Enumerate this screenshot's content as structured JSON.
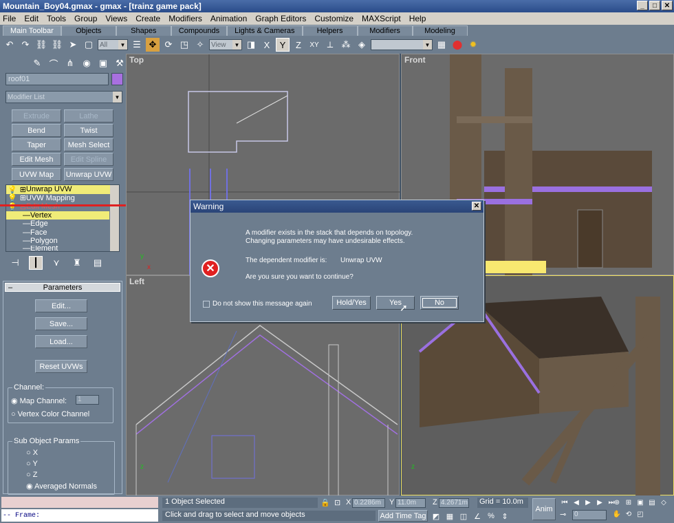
{
  "window": {
    "title": "Mountain_Boy04.gmax - gmax - [trainz game pack]",
    "min": "_",
    "max": "□",
    "close": "✕"
  },
  "menu": [
    "File",
    "Edit",
    "Tools",
    "Group",
    "Views",
    "Create",
    "Modifiers",
    "Animation",
    "Graph Editors",
    "Customize",
    "MAXScript",
    "Help"
  ],
  "tabs": [
    "Main Toolbar",
    "Objects",
    "Shapes",
    "Compounds",
    "Lights & Cameras",
    "Helpers",
    "Modifiers",
    "Modeling"
  ],
  "toolbar": {
    "filter_value": "All",
    "refcoord_value": "View",
    "selection_set": ""
  },
  "panel": {
    "object_name": "roof01",
    "modifier_list": "Modifier List",
    "buttons": [
      "Extrude",
      "Lathe",
      "Bend",
      "Twist",
      "Taper",
      "Mesh Select",
      "Edit Mesh",
      "Edit Spline",
      "UVW Map",
      "Unwrap UVW"
    ],
    "stack": [
      "Unwrap UVW",
      "UVW Mapping",
      "Edit Mesh",
      "Vertex",
      "Edge",
      "Face",
      "Polygon",
      "Element"
    ],
    "rollout_title": "Parameters",
    "edit_label": "Edit...",
    "save_label": "Save...",
    "load_label": "Load...",
    "reset_label": "Reset UVWs",
    "channel_title": "Channel:",
    "map_channel_label": "Map Channel:",
    "map_channel_value": "1",
    "vertex_color_label": "Vertex Color Channel",
    "subobj_title": "Sub Object Params",
    "axis_x": "X",
    "axis_y": "Y",
    "axis_z": "Z",
    "averaged_normals": "Averaged Normals"
  },
  "viewports": {
    "top": "Top",
    "front": "Front",
    "left": "Left",
    "persp": ""
  },
  "dialog": {
    "title": "Warning",
    "line1": "A modifier exists in the stack that depends on topology.",
    "line2": "Changing parameters may have undesirable effects.",
    "dep_label": "The dependent modifier is:",
    "dep_value": "Unwrap UVW",
    "question": "Are you sure you want to continue?",
    "checkbox_label": "Do not show this message again",
    "btn_hold": "Hold/Yes",
    "btn_yes": "Yes",
    "btn_no": "No"
  },
  "status": {
    "script_line": "-- Frame:",
    "selection": "1 Object Selected",
    "prompt": "Click and drag to select and move objects",
    "x_value": "0.2286m",
    "y_value": "11.0m",
    "z_value": "4.2671m",
    "grid": "Grid = 10.0m",
    "add_time_tag": "Add Time Tag",
    "anim": "Anim",
    "frame": "0"
  }
}
